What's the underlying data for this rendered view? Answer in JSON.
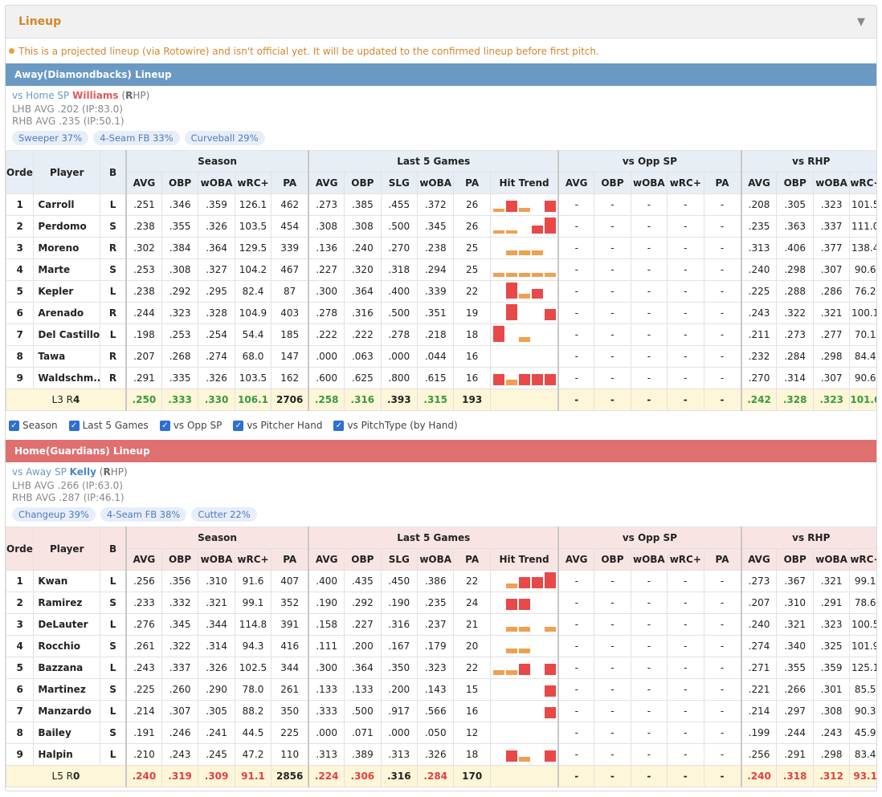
{
  "panel": {
    "title": "Lineup",
    "notice": "This is a projected lineup (via Rotowire) and isn't official yet. It will be updated to the confirmed lineup before first pitch."
  },
  "colors": {
    "accent": "#d4862a",
    "away": "#6a99c4",
    "home": "#e07070",
    "good": "#3a9a3a",
    "bad": "#e04040"
  },
  "headers": {
    "order": "Order",
    "player": "Player",
    "b": "B",
    "groups": [
      "Season",
      "Last 5 Games",
      "vs Opp SP",
      "vs RHP"
    ],
    "season": [
      "AVG",
      "OBP",
      "wOBA",
      "wRC+",
      "PA"
    ],
    "last5": [
      "AVG",
      "OBP",
      "SLG",
      "wOBA",
      "PA",
      "Hit Trend"
    ],
    "opp": [
      "AVG",
      "OBP",
      "wOBA",
      "wRC+",
      "PA"
    ],
    "rhp": [
      "AVG",
      "OBP",
      "wOBA",
      "wRC+"
    ]
  },
  "toggles": [
    "Season",
    "Last 5 Games",
    "vs Opp SP",
    "vs Pitcher Hand",
    "vs PitchType (by Hand)"
  ],
  "away": {
    "title": "Away(Diamondbacks) Lineup",
    "sp_prefix": "vs Home SP",
    "sp_name": "Williams",
    "hand_open": "(",
    "hand_letter": "R",
    "hand_rest": "HP)",
    "lhb": "LHB AVG .202 (IP:83.0)",
    "rhb": "RHB AVG .235 (IP:50.1)",
    "pitches": [
      "Sweeper 37%",
      "4-Seam FB 33%",
      "Curveball 29%"
    ],
    "rows": [
      {
        "o": "1",
        "name": "Carroll",
        "b": "L",
        "s": [
          ".251",
          ".346",
          ".359",
          "126.1",
          "462"
        ],
        "l5": [
          ".273",
          ".385",
          ".455",
          ".372",
          "26"
        ],
        "trend": [
          [
            "o",
            0.2
          ],
          [
            "r",
            0.7
          ],
          [
            "o",
            0.25
          ],
          [
            "n",
            0
          ],
          [
            "r",
            0.7
          ]
        ],
        "opp": [
          "-",
          "-",
          "-",
          "-",
          "-"
        ],
        "rhp": [
          ".208",
          ".305",
          ".323",
          "101.5"
        ]
      },
      {
        "o": "2",
        "name": "Perdomo",
        "b": "S",
        "s": [
          ".238",
          ".355",
          ".326",
          "103.5",
          "454"
        ],
        "l5": [
          ".308",
          ".308",
          ".500",
          ".345",
          "26"
        ],
        "trend": [
          [
            "o",
            0.2
          ],
          [
            "o",
            0.2
          ],
          [
            "n",
            0
          ],
          [
            "r",
            0.5
          ],
          [
            "r",
            1
          ]
        ],
        "opp": [
          "-",
          "-",
          "-",
          "-",
          "-"
        ],
        "rhp": [
          ".235",
          ".363",
          ".337",
          "111.0"
        ]
      },
      {
        "o": "3",
        "name": "Moreno",
        "b": "R",
        "s": [
          ".302",
          ".384",
          ".364",
          "129.5",
          "339"
        ],
        "l5": [
          ".136",
          ".240",
          ".238",
          "25"
        ],
        "l5fix": [
          ".136",
          ".240",
          ".270",
          ".238",
          "25"
        ],
        "trend": [
          [
            "n",
            0
          ],
          [
            "o",
            0.3
          ],
          [
            "o",
            0.3
          ],
          [
            "o",
            0.3
          ],
          [
            "n",
            0
          ]
        ],
        "opp": [
          "-",
          "-",
          "-",
          "-",
          "-"
        ],
        "rhp": [
          ".313",
          ".406",
          ".377",
          "138.4"
        ]
      },
      {
        "o": "4",
        "name": "Marte",
        "b": "S",
        "s": [
          ".253",
          ".308",
          ".327",
          "104.2",
          "467"
        ],
        "l5": [
          ".227",
          ".320",
          ".318",
          ".294",
          "25"
        ],
        "trend": [
          [
            "o",
            0.25
          ],
          [
            "o",
            0.25
          ],
          [
            "o",
            0.25
          ],
          [
            "o",
            0.25
          ],
          [
            "o",
            0.25
          ]
        ],
        "opp": [
          "-",
          "-",
          "-",
          "-",
          "-"
        ],
        "rhp": [
          ".240",
          ".298",
          ".307",
          "90.6"
        ]
      },
      {
        "o": "5",
        "name": "Kepler",
        "b": "L",
        "s": [
          ".238",
          ".292",
          ".295",
          "82.4",
          "87"
        ],
        "l5": [
          ".300",
          ".364",
          ".400",
          ".339",
          "22"
        ],
        "trend": [
          [
            "n",
            0
          ],
          [
            "r",
            1
          ],
          [
            "o",
            0.3
          ],
          [
            "r",
            0.6
          ],
          [
            "n",
            0
          ]
        ],
        "opp": [
          "-",
          "-",
          "-",
          "-",
          "-"
        ],
        "rhp": [
          ".225",
          ".288",
          ".286",
          "76.2"
        ]
      },
      {
        "o": "6",
        "name": "Arenado",
        "b": "R",
        "s": [
          ".244",
          ".323",
          ".328",
          "104.9",
          "403"
        ],
        "l5": [
          ".278",
          ".316",
          ".500",
          ".351",
          "19"
        ],
        "trend": [
          [
            "n",
            0
          ],
          [
            "r",
            1
          ],
          [
            "n",
            0
          ],
          [
            "n",
            0
          ],
          [
            "r",
            0.7
          ]
        ],
        "opp": [
          "-",
          "-",
          "-",
          "-",
          "-"
        ],
        "rhp": [
          ".243",
          ".322",
          ".321",
          "100.1"
        ]
      },
      {
        "o": "7",
        "name": "Del Castillo",
        "b": "L",
        "s": [
          ".198",
          ".253",
          ".254",
          "54.4",
          "185"
        ],
        "l5": [
          ".222",
          ".222",
          ".278",
          ".218",
          "18"
        ],
        "trend": [
          [
            "r",
            1
          ],
          [
            "n",
            0
          ],
          [
            "o",
            0.3
          ],
          [
            "n",
            0
          ],
          [
            "n",
            0
          ]
        ],
        "opp": [
          "-",
          "-",
          "-",
          "-",
          "-"
        ],
        "rhp": [
          ".211",
          ".273",
          ".277",
          "70.1"
        ]
      },
      {
        "o": "8",
        "name": "Tawa",
        "b": "R",
        "s": [
          ".207",
          ".268",
          ".274",
          "68.0",
          "147"
        ],
        "l5": [
          ".000",
          ".063",
          ".000",
          ".044",
          "16"
        ],
        "trend": [
          [
            "n",
            0
          ],
          [
            "n",
            0
          ],
          [
            "n",
            0
          ],
          [
            "n",
            0
          ],
          [
            "n",
            0
          ]
        ],
        "opp": [
          "-",
          "-",
          "-",
          "-",
          "-"
        ],
        "rhp": [
          ".232",
          ".284",
          ".298",
          "84.4"
        ]
      },
      {
        "o": "9",
        "name": "Waldschm...",
        "b": "R",
        "s": [
          ".291",
          ".335",
          ".326",
          "103.5",
          "162"
        ],
        "l5": [
          ".600",
          ".625",
          ".800",
          ".615",
          "16"
        ],
        "trend": [
          [
            "r",
            0.7
          ],
          [
            "o",
            0.35
          ],
          [
            "r",
            0.7
          ],
          [
            "r",
            0.7
          ],
          [
            "r",
            0.7
          ]
        ],
        "opp": [
          "-",
          "-",
          "-",
          "-",
          "-"
        ],
        "rhp": [
          ".270",
          ".314",
          ".307",
          "90.6"
        ]
      }
    ],
    "total": {
      "label_a": "L3 R",
      "label_b": "4",
      "s": [
        ".250",
        ".333",
        ".330",
        "106.1",
        "2706"
      ],
      "sc": [
        "good",
        "good",
        "good",
        "good",
        ""
      ],
      "l5": [
        ".258",
        ".316",
        ".393",
        ".315",
        "193"
      ],
      "l5c": [
        "good",
        "good",
        "",
        "good",
        ""
      ],
      "opp": [
        "-",
        "-",
        "-",
        "-",
        "-"
      ],
      "rhp": [
        ".242",
        ".328",
        ".323",
        "101.6"
      ],
      "rc": [
        "good",
        "good",
        "good",
        "good"
      ]
    }
  },
  "home": {
    "title": "Home(Guardians) Lineup",
    "sp_prefix": "vs Away SP",
    "sp_name": "Kelly",
    "hand_open": "(",
    "hand_letter": "R",
    "hand_rest": "HP)",
    "lhb": "LHB AVG .266 (IP:63.0)",
    "rhb": "RHB AVG .287 (IP:46.1)",
    "pitches": [
      "Changeup 39%",
      "4-Seam FB 38%",
      "Cutter 22%"
    ],
    "rows": [
      {
        "o": "1",
        "name": "Kwan",
        "b": "L",
        "s": [
          ".256",
          ".356",
          ".310",
          "91.6",
          "407"
        ],
        "l5": [
          ".400",
          ".435",
          ".450",
          ".386",
          "22"
        ],
        "trend": [
          [
            "n",
            0
          ],
          [
            "o",
            0.3
          ],
          [
            "r",
            0.7
          ],
          [
            "r",
            0.7
          ],
          [
            "r",
            1
          ]
        ],
        "opp": [
          "-",
          "-",
          "-",
          "-",
          "-"
        ],
        "rhp": [
          ".273",
          ".367",
          ".321",
          "99.1"
        ]
      },
      {
        "o": "2",
        "name": "Ramirez",
        "b": "S",
        "s": [
          ".233",
          ".332",
          ".321",
          "99.1",
          "352"
        ],
        "l5": [
          ".190",
          ".292",
          ".190",
          ".235",
          "24"
        ],
        "trend": [
          [
            "n",
            0
          ],
          [
            "r",
            0.7
          ],
          [
            "r",
            0.7
          ],
          [
            "n",
            0
          ],
          [
            "n",
            0
          ]
        ],
        "opp": [
          "-",
          "-",
          "-",
          "-",
          "-"
        ],
        "rhp": [
          ".207",
          ".310",
          ".291",
          "78.6"
        ]
      },
      {
        "o": "3",
        "name": "DeLauter",
        "b": "L",
        "s": [
          ".276",
          ".345",
          ".344",
          "114.8",
          "391"
        ],
        "l5": [
          ".158",
          ".227",
          ".316",
          ".237",
          "21"
        ],
        "trend": [
          [
            "n",
            0
          ],
          [
            "o",
            0.3
          ],
          [
            "o",
            0.3
          ],
          [
            "n",
            0
          ],
          [
            "o",
            0.3
          ]
        ],
        "opp": [
          "-",
          "-",
          "-",
          "-",
          "-"
        ],
        "rhp": [
          ".240",
          ".321",
          ".323",
          "100.5"
        ]
      },
      {
        "o": "4",
        "name": "Rocchio",
        "b": "S",
        "s": [
          ".261",
          ".322",
          ".314",
          "94.3",
          "416"
        ],
        "l5": [
          ".111",
          ".200",
          ".167",
          ".179",
          "20"
        ],
        "trend": [
          [
            "n",
            0
          ],
          [
            "o",
            0.3
          ],
          [
            "o",
            0.3
          ],
          [
            "n",
            0
          ],
          [
            "n",
            0
          ]
        ],
        "opp": [
          "-",
          "-",
          "-",
          "-",
          "-"
        ],
        "rhp": [
          ".274",
          ".340",
          ".325",
          "101.9"
        ]
      },
      {
        "o": "5",
        "name": "Bazzana",
        "b": "L",
        "s": [
          ".243",
          ".337",
          ".326",
          "102.5",
          "344"
        ],
        "l5": [
          ".300",
          ".364",
          ".350",
          ".323",
          "22"
        ],
        "trend": [
          [
            "o",
            0.3
          ],
          [
            "o",
            0.3
          ],
          [
            "r",
            0.7
          ],
          [
            "n",
            0
          ],
          [
            "r",
            0.7
          ]
        ],
        "opp": [
          "-",
          "-",
          "-",
          "-",
          "-"
        ],
        "rhp": [
          ".271",
          ".355",
          ".359",
          "125.1"
        ]
      },
      {
        "o": "6",
        "name": "Martinez",
        "b": "S",
        "s": [
          ".225",
          ".260",
          ".290",
          "78.0",
          "261"
        ],
        "l5": [
          ".133",
          ".133",
          ".200",
          ".143",
          "15"
        ],
        "trend": [
          [
            "n",
            0
          ],
          [
            "n",
            0
          ],
          [
            "n",
            0
          ],
          [
            "n",
            0
          ],
          [
            "r",
            0.7
          ]
        ],
        "opp": [
          "-",
          "-",
          "-",
          "-",
          "-"
        ],
        "rhp": [
          ".221",
          ".266",
          ".301",
          "85.5"
        ]
      },
      {
        "o": "7",
        "name": "Manzardo",
        "b": "L",
        "s": [
          ".214",
          ".307",
          ".305",
          "88.2",
          "350"
        ],
        "l5": [
          ".333",
          ".500",
          ".917",
          ".566",
          "16"
        ],
        "trend": [
          [
            "n",
            0
          ],
          [
            "n",
            0
          ],
          [
            "n",
            0
          ],
          [
            "n",
            0
          ],
          [
            "r",
            0.7
          ]
        ],
        "opp": [
          "-",
          "-",
          "-",
          "-",
          "-"
        ],
        "rhp": [
          ".214",
          ".297",
          ".308",
          "90.3"
        ]
      },
      {
        "o": "8",
        "name": "Bailey",
        "b": "S",
        "s": [
          ".191",
          ".246",
          ".241",
          "44.5",
          "225"
        ],
        "l5": [
          ".000",
          ".071",
          ".000",
          ".050",
          "12"
        ],
        "trend": [
          [
            "n",
            0
          ],
          [
            "n",
            0
          ],
          [
            "n",
            0
          ],
          [
            "n",
            0
          ],
          [
            "n",
            0
          ]
        ],
        "opp": [
          "-",
          "-",
          "-",
          "-",
          "-"
        ],
        "rhp": [
          ".199",
          ".244",
          ".243",
          "45.9"
        ]
      },
      {
        "o": "9",
        "name": "Halpin",
        "b": "L",
        "s": [
          ".210",
          ".243",
          ".245",
          "47.2",
          "110"
        ],
        "l5": [
          ".313",
          ".389",
          ".313",
          ".326",
          "18"
        ],
        "trend": [
          [
            "n",
            0
          ],
          [
            "r",
            0.7
          ],
          [
            "o",
            0.3
          ],
          [
            "n",
            0
          ],
          [
            "r",
            0.7
          ]
        ],
        "opp": [
          "-",
          "-",
          "-",
          "-",
          "-"
        ],
        "rhp": [
          ".256",
          ".291",
          ".298",
          "83.4"
        ]
      }
    ],
    "total": {
      "label_a": "L5 R",
      "label_b": "0",
      "s": [
        ".240",
        ".319",
        ".309",
        "91.1",
        "2856"
      ],
      "sc": [
        "bad",
        "bad",
        "bad",
        "bad",
        ""
      ],
      "l5": [
        ".224",
        ".306",
        ".316",
        ".284",
        "170"
      ],
      "l5c": [
        "bad",
        "bad",
        "",
        "bad",
        ""
      ],
      "opp": [
        "-",
        "-",
        "-",
        "-",
        "-"
      ],
      "rhp": [
        ".240",
        ".318",
        ".312",
        "93.1"
      ],
      "rc": [
        "bad",
        "bad",
        "bad",
        "bad"
      ]
    }
  }
}
